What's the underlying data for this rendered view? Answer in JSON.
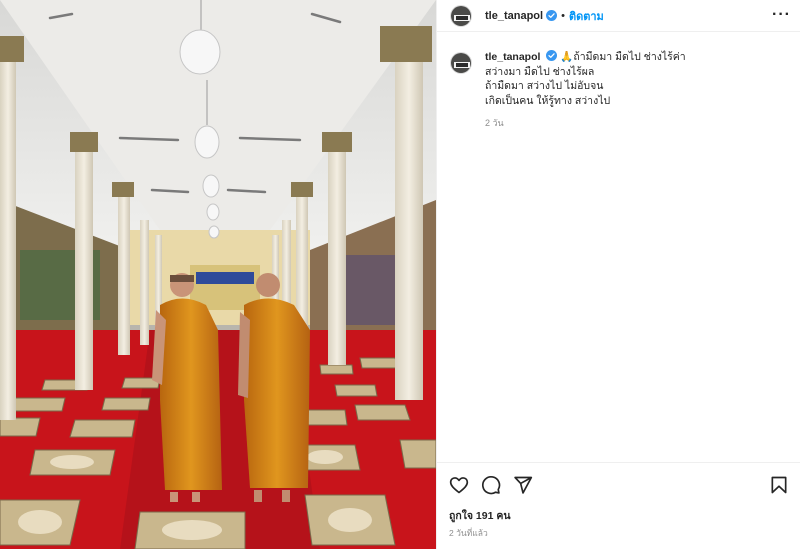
{
  "post": {
    "username": "tle_tanapol",
    "follow_label": "ติดตาม",
    "separator": "•",
    "more_label": "···"
  },
  "caption": {
    "username": "tle_tanapol",
    "lines": [
      "🙏ถ้ามืดมา มืดไป ช่างไร้ค่า",
      "สว่างมา มืดไป ช่างไร้ผล",
      "ถ้ามืดมา สว่างไป ไม่อับจน",
      "เกิดเป็นคน ให้รู้ทาง สว่างไป"
    ],
    "time": "2 วัน"
  },
  "footer": {
    "likes": "ถูกใจ 191 คน",
    "time": "2 วันที่แล้ว"
  },
  "icons": {
    "verified": "verified-badge-icon",
    "like": "heart-icon",
    "comment": "comment-icon",
    "share": "send-icon",
    "save": "bookmark-icon"
  },
  "colors": {
    "follow": "#0095f6",
    "verified": "#3897f0",
    "carpet": "#c8141b",
    "robe": "#d98a19"
  }
}
